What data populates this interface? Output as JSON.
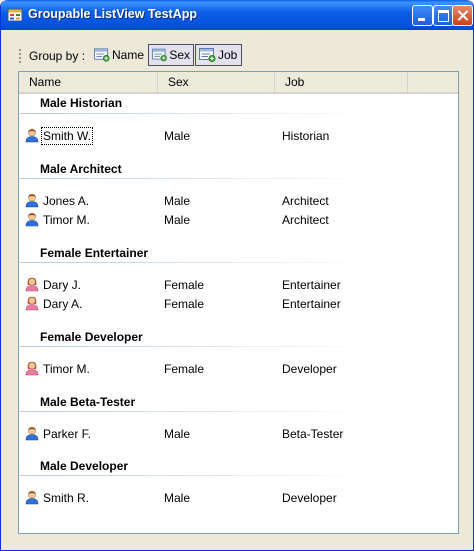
{
  "window": {
    "title": "Groupable ListView TestApp"
  },
  "toolbar": {
    "group_by_label": "Group by :",
    "buttons": [
      {
        "label": "Name",
        "checked": false
      },
      {
        "label": "Sex",
        "checked": true
      },
      {
        "label": "Job",
        "checked": true
      }
    ]
  },
  "columns": [
    "Name",
    "Sex",
    "Job"
  ],
  "groups": [
    {
      "title": "Male Historian",
      "rows": [
        {
          "name": "Smith W.",
          "sex": "Male",
          "job": "Historian",
          "icon": "male-user-icon"
        }
      ]
    },
    {
      "title": "Male Architect",
      "rows": [
        {
          "name": "Jones A.",
          "sex": "Male",
          "job": "Architect",
          "icon": "male-user-icon"
        },
        {
          "name": "Timor M.",
          "sex": "Male",
          "job": "Architect",
          "icon": "male-user-icon"
        }
      ]
    },
    {
      "title": "Female Entertainer",
      "rows": [
        {
          "name": "Dary J.",
          "sex": "Female",
          "job": "Entertainer",
          "icon": "female-user-icon"
        },
        {
          "name": "Dary A.",
          "sex": "Female",
          "job": "Entertainer",
          "icon": "female-user-icon"
        }
      ]
    },
    {
      "title": "Female Developer",
      "rows": [
        {
          "name": "Timor M.",
          "sex": "Female",
          "job": "Developer",
          "icon": "female-user-icon"
        }
      ]
    },
    {
      "title": "Male Beta-Tester",
      "rows": [
        {
          "name": "Parker F.",
          "sex": "Male",
          "job": "Beta-Tester",
          "icon": "male-user-icon"
        }
      ]
    },
    {
      "title": "Male Developer",
      "rows": [
        {
          "name": "Smith R.",
          "sex": "Male",
          "job": "Developer",
          "icon": "male-user-icon"
        }
      ]
    }
  ],
  "colors": {
    "titlebar": "#0550dc",
    "male_shirt": "#2f6fd6",
    "female_shirt": "#e87ba0",
    "skin": "#f3c79b"
  }
}
